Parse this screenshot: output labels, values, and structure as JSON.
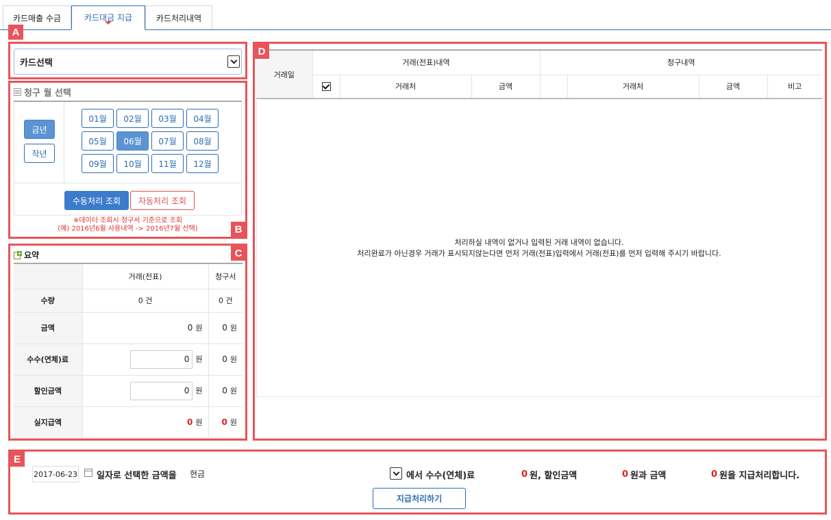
{
  "tabs": [
    {
      "label": "카드매출 수금"
    },
    {
      "label": "카드대금 지급"
    },
    {
      "label": "카드처리내역"
    }
  ],
  "badges": {
    "a": "A",
    "b": "B",
    "c": "C",
    "d": "D",
    "e": "E"
  },
  "card_select": {
    "value": "카드선택"
  },
  "billing_month": {
    "title": "청구 월 선택",
    "years": [
      "금년",
      "작년"
    ],
    "selected_year": "금년",
    "months": [
      "01월",
      "02월",
      "03월",
      "04월",
      "05월",
      "06월",
      "07월",
      "08월",
      "09월",
      "10월",
      "11월",
      "12월"
    ],
    "selected_month": "06월",
    "manual_button": "수동처리 조회",
    "auto_button": "자동처리 조회",
    "note_line1": "※데이터 조회시 청구서 기준으로 조회",
    "note_line2": "(예) 2016년6월 사용내역 -> 2016년7월 선택)"
  },
  "summary": {
    "title": "요약",
    "col_transaction": "거래(전표)",
    "col_invoice": "청구서",
    "rows": {
      "qty": {
        "label": "수량",
        "tx": "0 건",
        "inv": "0 건"
      },
      "amount": {
        "label": "금액",
        "tx": "0",
        "inv": "0"
      },
      "fee": {
        "label": "수수(연체)료",
        "tx": "0",
        "inv": "0"
      },
      "discount": {
        "label": "할인금액",
        "tx": "0",
        "inv": "0"
      },
      "actual": {
        "label": "실지급액",
        "tx": "0",
        "inv": "0"
      }
    },
    "unit_won": "원"
  },
  "details": {
    "col_date": "거래일",
    "group_transaction": "거래(전표)내역",
    "group_invoice": "청구내역",
    "col_vendor": "거래처",
    "col_amount": "금액",
    "col_note": "비고",
    "empty_line1": "처리하실 내역이 없거나 입력된 거래 내역이 없습니다.",
    "empty_line2": "처리완료가 아닌경우 거래가 표시되지않는다면 먼저 거래(전표)입력에서 거래(전표)를 먼저 입력해 주시기 바랍니다."
  },
  "payment": {
    "date": "2017-06-23",
    "text_selected": "일자로 선택한 금액을",
    "method": "현금",
    "text_fee": "에서 수수(연체)료",
    "fee_value": "0",
    "text_discount": "원, 할인금액",
    "discount_value": "0",
    "text_amount": "원과 금액",
    "amount_value": "0",
    "text_end": "원을 지급처리합니다.",
    "submit_button": "지급처리하기"
  }
}
